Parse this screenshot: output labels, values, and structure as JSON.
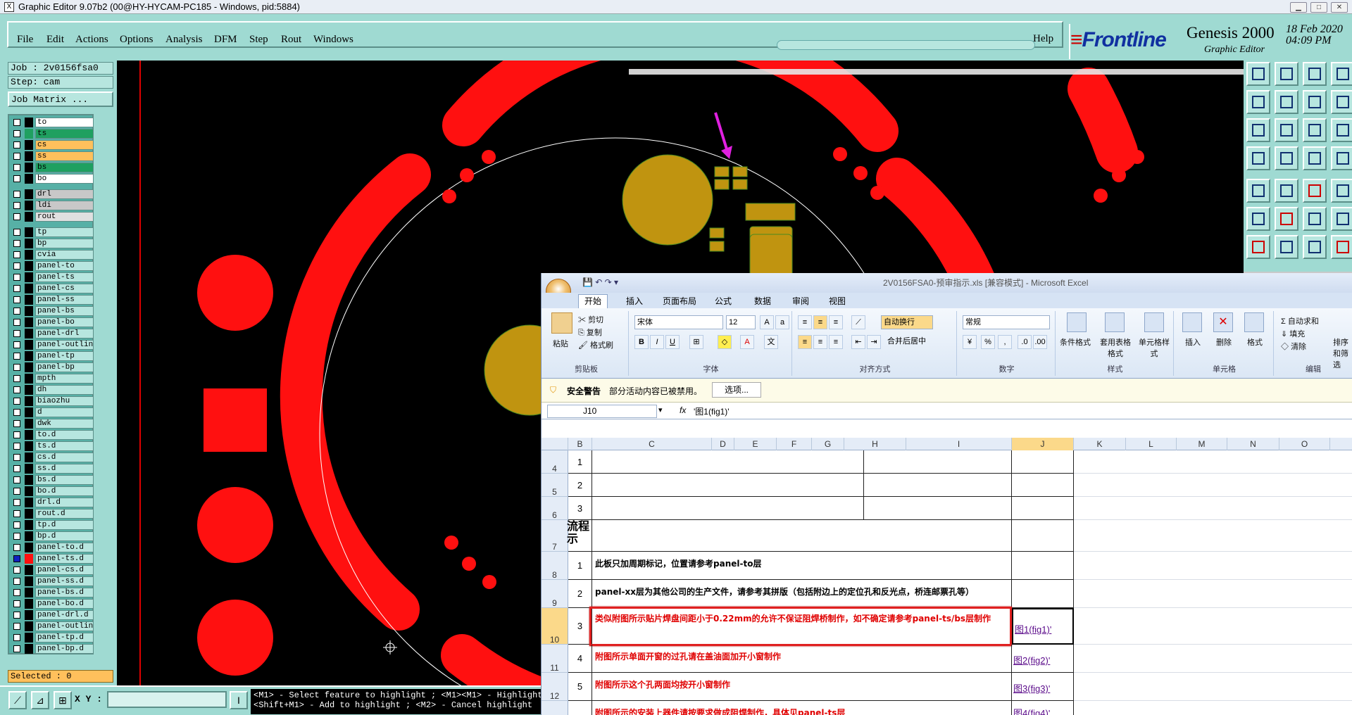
{
  "window": {
    "title": "Graphic Editor 9.07b2 (00@HY-HYCAM-PC185 - Windows, pid:5884)",
    "icon": "X"
  },
  "menu": [
    "File",
    "Edit",
    "Actions",
    "Options",
    "Analysis",
    "DFM",
    "Step",
    "Rout",
    "Windows"
  ],
  "help": "Help",
  "brand": {
    "logo_front": "Frontline",
    "product": "Genesis 2000",
    "subtitle": "Graphic Editor",
    "date": "18 Feb 2020",
    "time": "04:09 PM"
  },
  "job": {
    "job": "Job : 2v0156fsa0",
    "step": "Step: cam",
    "matrix_btn": "Job Matrix ..."
  },
  "layers": [
    {
      "name": "to",
      "color": "#ffffff",
      "swatch": "#000000"
    },
    {
      "name": "ts",
      "color": "#1fa060",
      "swatch": "#1fa060"
    },
    {
      "name": "cs",
      "color": "#ffc05c",
      "swatch": "#000000"
    },
    {
      "name": "ss",
      "color": "#ffc05c",
      "swatch": "#000000"
    },
    {
      "name": "bs",
      "color": "#1fa060",
      "swatch": "#000000"
    },
    {
      "name": "bo",
      "color": "#ffffff",
      "swatch": "#000000"
    },
    {
      "name": "drl",
      "color": "#c8c8c8",
      "swatch": "#000000"
    },
    {
      "name": "ldi",
      "color": "#c8c8c8",
      "swatch": "#000000"
    },
    {
      "name": "rout",
      "color": "#e0e0e0",
      "swatch": "#000000"
    },
    {
      "name": "tp"
    },
    {
      "name": "bp"
    },
    {
      "name": "cvia"
    },
    {
      "name": "panel-to"
    },
    {
      "name": "panel-ts"
    },
    {
      "name": "panel-cs"
    },
    {
      "name": "panel-ss"
    },
    {
      "name": "panel-bs"
    },
    {
      "name": "panel-bo"
    },
    {
      "name": "panel-drl"
    },
    {
      "name": "panel-outline"
    },
    {
      "name": "panel-tp"
    },
    {
      "name": "panel-bp"
    },
    {
      "name": "mpth"
    },
    {
      "name": "dh"
    },
    {
      "name": "biaozhu"
    },
    {
      "name": "d"
    },
    {
      "name": "dwk"
    },
    {
      "name": "to.d"
    },
    {
      "name": "ts.d"
    },
    {
      "name": "cs.d"
    },
    {
      "name": "ss.d"
    },
    {
      "name": "bs.d"
    },
    {
      "name": "bo.d"
    },
    {
      "name": "drl.d"
    },
    {
      "name": "rout.d"
    },
    {
      "name": "tp.d"
    },
    {
      "name": "bp.d"
    },
    {
      "name": "panel-to.d"
    },
    {
      "name": "panel-ts.d",
      "active": true
    },
    {
      "name": "panel-cs.d"
    },
    {
      "name": "panel-ss.d"
    },
    {
      "name": "panel-bs.d"
    },
    {
      "name": "panel-bo.d"
    },
    {
      "name": "panel-drl.d"
    },
    {
      "name": "panel-outline.d"
    },
    {
      "name": "panel-tp.d"
    },
    {
      "name": "panel-bp.d"
    }
  ],
  "selected": "Selected : 0",
  "xy_label": "X Y :",
  "xy_value": "",
  "hint_lines": [
    "<M1> - Select feature to highlight ; <M1><M1> - Highlight i",
    "<Shift+M1> - Add to highlight ; <M2> - Cancel highlight"
  ],
  "excel": {
    "title": "2V0156FSA0-预审指示.xls [兼容模式] - Microsoft Excel",
    "tabs": [
      "开始",
      "插入",
      "页面布局",
      "公式",
      "数据",
      "审阅",
      "视图"
    ],
    "clipboard": {
      "paste": "粘贴",
      "cut": "剪切",
      "copy": "复制",
      "format_painter": "格式刷",
      "label": "剪贴板"
    },
    "font": {
      "name": "宋体",
      "size": "12",
      "label": "字体"
    },
    "align": {
      "wrap": "自动换行",
      "merge": "合并后居中",
      "label": "对齐方式"
    },
    "number": {
      "format": "常规",
      "label": "数字"
    },
    "styles": {
      "cond": "条件格式",
      "table": "套用表格格式",
      "cell": "单元格样式",
      "label": "样式"
    },
    "cells": {
      "insert": "插入",
      "delete": "删除",
      "format": "格式",
      "label": "单元格"
    },
    "edit": {
      "autosum": "自动求和",
      "fill": "填充",
      "clear": "清除",
      "sort": "排序和筛选",
      "label": "编辑"
    },
    "security": {
      "title": "安全警告",
      "msg": "部分活动内容已被禁用。",
      "btn": "选项..."
    },
    "namebox": "J10",
    "formula": "'图1(fig1)'",
    "columns": [
      "B",
      "C",
      "D",
      "E",
      "F",
      "G",
      "H",
      "I",
      "J",
      "K",
      "L",
      "M",
      "N",
      "O"
    ],
    "rows": [
      {
        "rh": "4",
        "num": "1",
        "text": "",
        "link": ""
      },
      {
        "rh": "5",
        "num": "2",
        "text": "",
        "link": ""
      },
      {
        "rh": "6",
        "num": "3",
        "text": "",
        "link": ""
      },
      {
        "rh": "7",
        "num": "",
        "text": "流程\n示",
        "link": ""
      },
      {
        "rh": "8",
        "num": "1",
        "text": "此板只加周期标记，位置请参考panel-to层",
        "link": "",
        "red": false
      },
      {
        "rh": "9",
        "num": "2",
        "text": "panel-xx层为其他公司的生产文件，请参考其拼版（包括附边上的定位孔和反光点，桥连邮票孔等）",
        "link": "",
        "red": false
      },
      {
        "rh": "10",
        "num": "3",
        "text": "类似附图所示贴片焊盘间距小于0.22mm的允许不保证阻焊桥制作，如不确定请参考panel-ts/bs层制作",
        "link": "图1(fig1)'",
        "red": true
      },
      {
        "rh": "11",
        "num": "4",
        "text": "附图所示单面开窗的过孔请在盖油面加开小窗制作",
        "link": "图2(fig2)'",
        "red": true
      },
      {
        "rh": "12",
        "num": "5",
        "text": "附图所示这个孔两面均按开小窗制作",
        "link": "图3(fig3)'",
        "red": true
      },
      {
        "rh": "",
        "num": "",
        "text": "附图所示的安装上器件请按要求做成阻焊制作，具体见panel-ts层",
        "link": "图4(fig4)'",
        "red": true
      }
    ]
  }
}
